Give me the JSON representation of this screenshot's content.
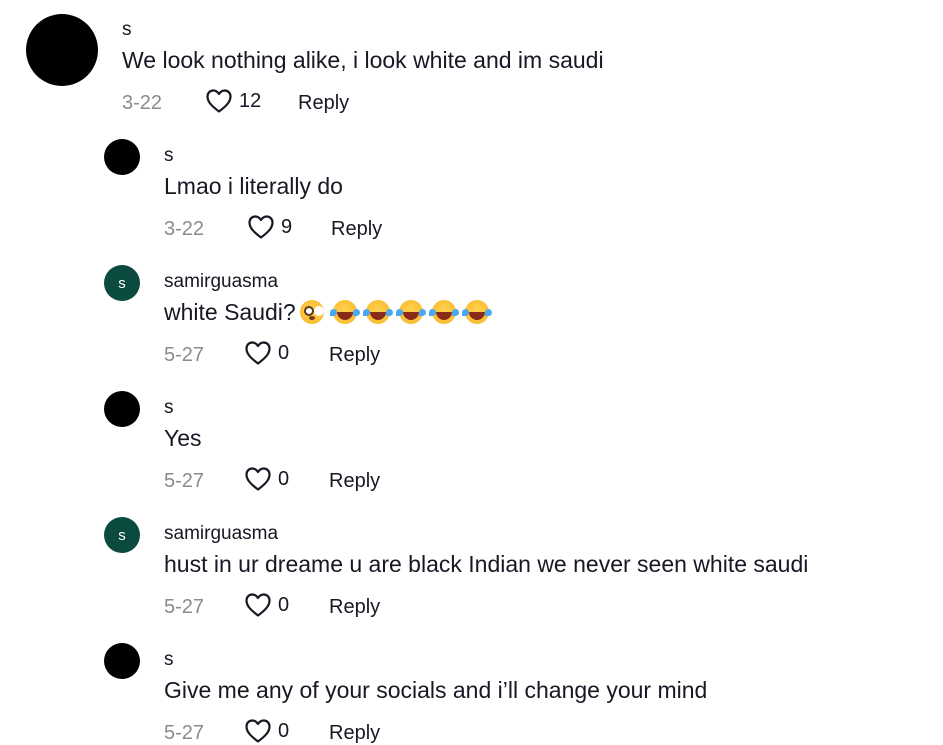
{
  "comments": [
    {
      "username": "s",
      "text": "We look nothing alike, i look white and im saudi",
      "date": "3-22",
      "likes": "12",
      "reply_label": "Reply",
      "avatar_icon": "black-circle-avatar"
    },
    {
      "username": "s",
      "text": "Lmao i literally do",
      "date": "3-22",
      "likes": "9",
      "reply_label": "Reply",
      "avatar_icon": "black-circle-avatar"
    },
    {
      "username": "samirguasma",
      "text": "white Saudi?",
      "emojis": [
        "flushed-face",
        "face-with-tears-of-joy",
        "face-with-tears-of-joy",
        "face-with-tears-of-joy",
        "face-with-tears-of-joy",
        "face-with-tears-of-joy"
      ],
      "date": "5-27",
      "likes": "0",
      "reply_label": "Reply",
      "avatar_letter": "s",
      "avatar_color": "#0b4a3f"
    },
    {
      "username": "s",
      "text": "Yes",
      "date": "5-27",
      "likes": "0",
      "reply_label": "Reply",
      "avatar_icon": "black-circle-avatar"
    },
    {
      "username": "samirguasma",
      "text": "hust in ur dreame u are black Indian we never seen white saudi",
      "date": "5-27",
      "likes": "0",
      "reply_label": "Reply",
      "avatar_letter": "s",
      "avatar_color": "#0b4a3f"
    },
    {
      "username": "s",
      "text": "Give me any of your socials and i’ll change your mind",
      "date": "5-27",
      "likes": "0",
      "reply_label": "Reply",
      "avatar_icon": "black-circle-avatar"
    }
  ],
  "colors": {
    "text": "#161823",
    "muted": "#8a8b91",
    "avatar_green": "#0b4a3f"
  }
}
